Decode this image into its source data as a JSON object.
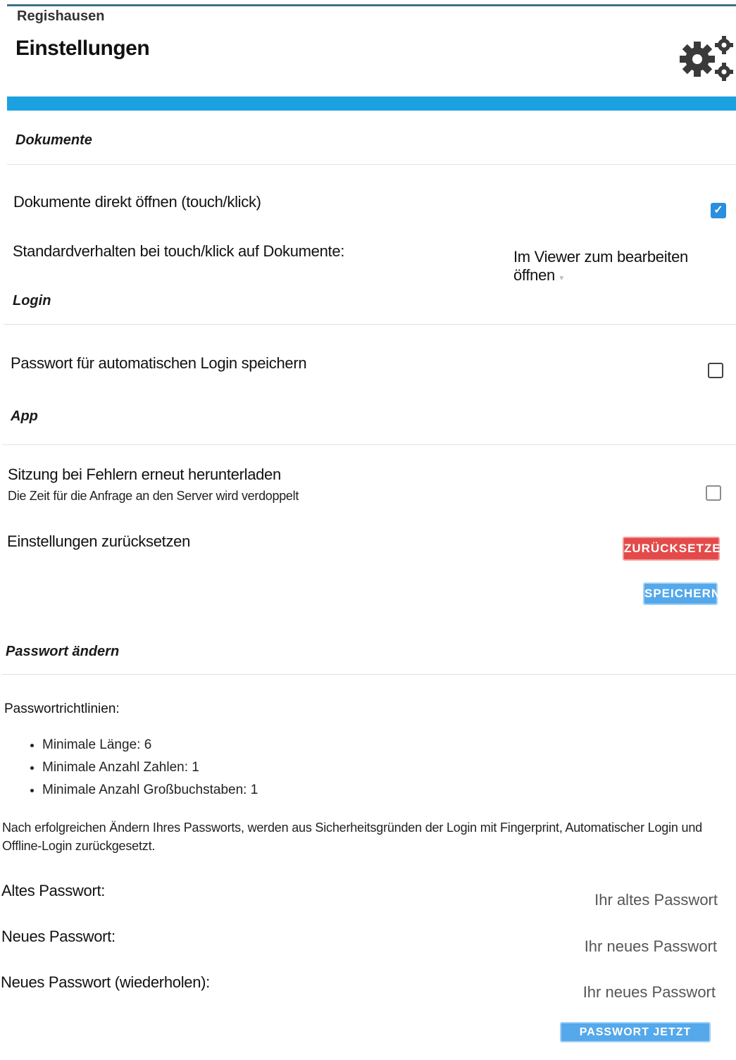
{
  "header": {
    "app_name": "Regishausen",
    "page_title": "Einstellungen",
    "icon": "gears-icon"
  },
  "sections": {
    "documents": {
      "title": "Dokumente",
      "open_direct_label": "Dokumente direkt öffnen (touch/klick)",
      "open_direct_checked": true,
      "default_behavior_label": "Standardverhalten bei touch/klick auf Dokumente:",
      "default_behavior_value": "Im Viewer zum bearbeiten öffnen"
    },
    "login": {
      "title": "Login",
      "save_password_label": "Passwort für automatischen Login speichern",
      "save_password_checked": false
    },
    "app": {
      "title": "App",
      "retry_label": "Sitzung bei Fehlern erneut herunterladen",
      "retry_description": "Die Zeit für die Anfrage an den Server wird verdoppelt",
      "retry_checked": false,
      "reset_label": "Einstellungen zurücksetzen",
      "reset_button": "ZURÜCKSETZEN",
      "save_button": "SPEICHERN"
    },
    "password": {
      "title": "Passwort ändern",
      "policy_heading": "Passwortrichtlinien:",
      "policies": [
        "Minimale Länge: 6",
        "Minimale Anzahl Zahlen: 1",
        "Minimale Anzahl Großbuchstaben: 1"
      ],
      "info_text": "Nach erfolgreichen Ändern Ihres Passworts, werden aus Sicherheitsgründen der Login mit Fingerprint, Automatischer Login und Offline-Login zurückgesetzt.",
      "old_label": "Altes Passwort:",
      "old_placeholder": "Ihr altes Passwort",
      "new_label": "Neues Passwort:",
      "new_placeholder": "Ihr neues Passwort",
      "repeat_label": "Neues Passwort (wiederholen):",
      "repeat_placeholder": "Ihr neues Passwort",
      "submit_button": "PASSWORT JETZT ÄNDERN"
    }
  },
  "colors": {
    "accent_bar": "#1ba0e0",
    "reset_red": "#e44a4a",
    "button_blue": "#55a8ea"
  }
}
